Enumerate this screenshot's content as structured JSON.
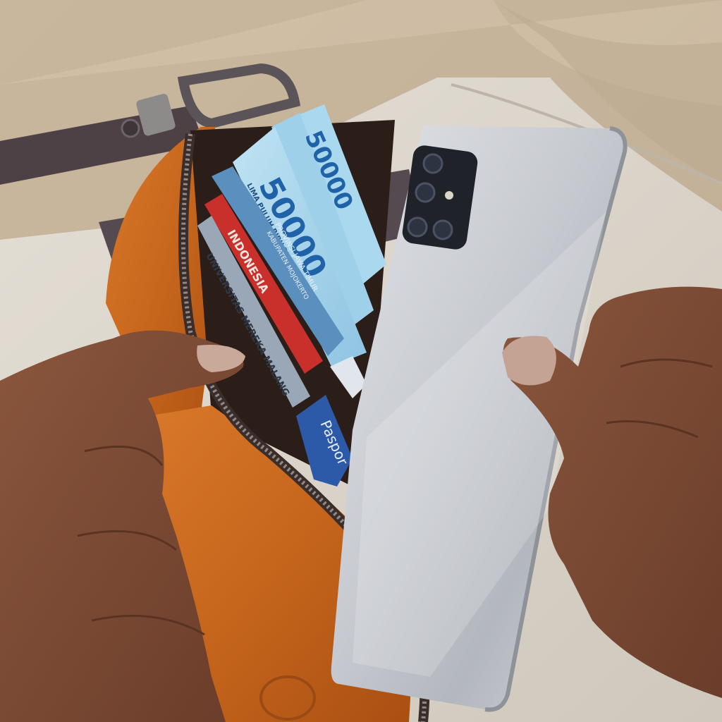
{
  "banknote": {
    "denomination": "50000",
    "words": "LIMA PULUH RIBU RUPIAH"
  },
  "cards": {
    "card_1_line_1": "PROVINSI JAWA TIMUR",
    "card_1_line_2": "KABUPATEN MOJOKERTO",
    "card_2": "INDONESIA",
    "card_3": "UNIVERSITAS MEREKA MALANG",
    "card_4": "Paspor"
  },
  "palette": {
    "fabric": "#cbb9a0",
    "wallet_leather": "#c8681e",
    "phone_body": "#c9ccd2",
    "banknote_blue": "#9fd0ea",
    "skin": "#7a4a35"
  }
}
